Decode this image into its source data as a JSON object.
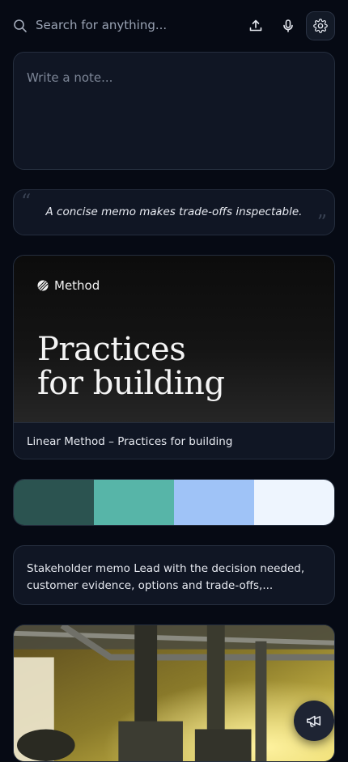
{
  "search": {
    "placeholder": "Search for anything..."
  },
  "note": {
    "placeholder": "Write a note..."
  },
  "quote": {
    "text": "A concise memo makes trade-offs inspectable."
  },
  "link_card": {
    "brand": "Method",
    "hero_title_line1": "Practices",
    "hero_title_line2": "for building",
    "caption": "Linear Method – Practices for building"
  },
  "palette": {
    "colors": [
      "#2b5350",
      "#57b5a8",
      "#9fc3f7",
      "#eef5fe"
    ]
  },
  "memo": {
    "text": "Stakeholder memo Lead with the decision needed, customer evidence, options and trade-offs,..."
  },
  "icons": {
    "search": "search-icon",
    "upload": "upload-icon",
    "mic": "mic-icon",
    "settings": "gear-icon",
    "fab": "megaphone-icon"
  }
}
